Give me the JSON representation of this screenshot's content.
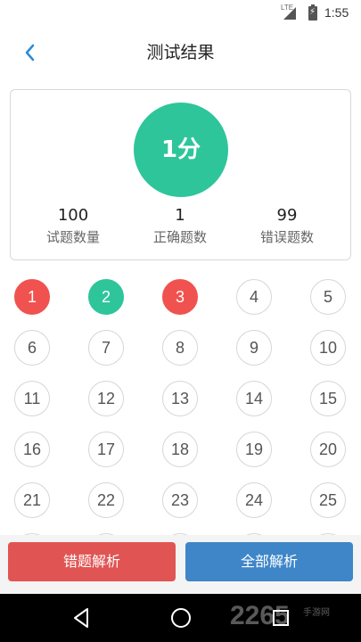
{
  "status_bar": {
    "network": "LTE",
    "time": "1:55",
    "battery_glyph": "⚡"
  },
  "nav": {
    "title": "测试结果",
    "back_icon": "chevron-left-icon",
    "accent": "#2a8bd6"
  },
  "result": {
    "score": "1分",
    "score_color": "#2ec59a",
    "stats": [
      {
        "value": "100",
        "label": "试题数量"
      },
      {
        "value": "1",
        "label": "正确题数"
      },
      {
        "value": "99",
        "label": "错误题数"
      }
    ]
  },
  "questions": [
    {
      "n": "1",
      "state": "wrong"
    },
    {
      "n": "2",
      "state": "right"
    },
    {
      "n": "3",
      "state": "wrong"
    },
    {
      "n": "4",
      "state": "none"
    },
    {
      "n": "5",
      "state": "none"
    },
    {
      "n": "6",
      "state": "none"
    },
    {
      "n": "7",
      "state": "none"
    },
    {
      "n": "8",
      "state": "none"
    },
    {
      "n": "9",
      "state": "none"
    },
    {
      "n": "10",
      "state": "none"
    },
    {
      "n": "11",
      "state": "none"
    },
    {
      "n": "12",
      "state": "none"
    },
    {
      "n": "13",
      "state": "none"
    },
    {
      "n": "14",
      "state": "none"
    },
    {
      "n": "15",
      "state": "none"
    },
    {
      "n": "16",
      "state": "none"
    },
    {
      "n": "17",
      "state": "none"
    },
    {
      "n": "18",
      "state": "none"
    },
    {
      "n": "19",
      "state": "none"
    },
    {
      "n": "20",
      "state": "none"
    },
    {
      "n": "21",
      "state": "none"
    },
    {
      "n": "22",
      "state": "none"
    },
    {
      "n": "23",
      "state": "none"
    },
    {
      "n": "24",
      "state": "none"
    },
    {
      "n": "25",
      "state": "none"
    }
  ],
  "buttons": {
    "wrong_analysis": "错题解析",
    "all_analysis": "全部解析"
  },
  "watermark": {
    "text": "2265",
    "sub": "手游网"
  }
}
